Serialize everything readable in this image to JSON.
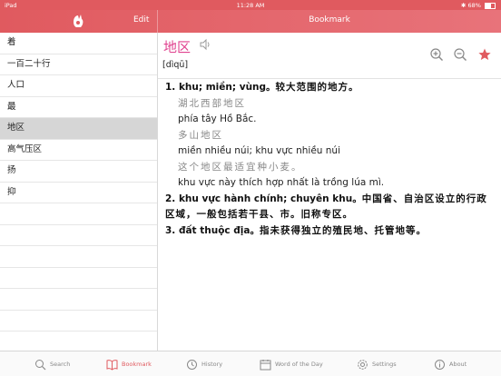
{
  "status": {
    "carrier": "iPad",
    "time": "11:28 AM",
    "battery": "68%"
  },
  "nav": {
    "edit_label": "Edit",
    "title": "Bookmark"
  },
  "sidebar": {
    "items": [
      "着",
      "一百二十行",
      "人口",
      "最",
      "地区",
      "高气压区",
      "扬",
      "抑"
    ],
    "selected_index": 4
  },
  "entry": {
    "headword": "地区",
    "pinyin": "[dìqū]",
    "line1_num": "1.",
    "line1_vi": "khu; miền; vùng。",
    "line1_zh": "较大范围的地方。",
    "ex1_zh": "湖北西部地区",
    "ex1_vi": "phía tây Hồ Bắc.",
    "ex2_zh": "多山地区",
    "ex2_vi": "miền nhiều núi; khu vực nhiều núi",
    "ex3_zh": "这个地区最适宜种小麦。",
    "ex3_vi": "khu vực này thích hợp nhất là trồng lúa mì.",
    "line2_num": "2.",
    "line2_vi": "khu vực hành chính; chuyên khu。",
    "line2_zh": "中国省、自治区设立的行政区域，一般包括若干县、市。旧称专区。",
    "line3_num": "3.",
    "line3_vi": "đất thuộc địa。",
    "line3_zh": "指未获得独立的殖民地、托管地等。"
  },
  "tabs": {
    "search": "Search",
    "bookmark": "Bookmark",
    "history": "History",
    "wotd": "Word of the Day",
    "settings": "Settings",
    "about": "About"
  },
  "colors": {
    "accent": "#e05a5f",
    "headword": "#e0438f"
  }
}
